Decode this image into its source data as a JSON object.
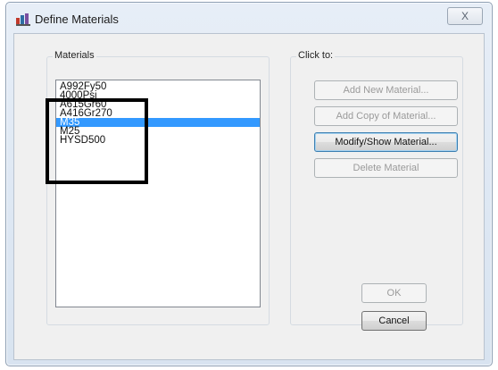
{
  "window": {
    "title": "Define Materials",
    "close_label": "X"
  },
  "materials_group": {
    "label": "Materials",
    "items": [
      {
        "label": "A992Fy50",
        "selected": false
      },
      {
        "label": "4000Psi",
        "selected": false
      },
      {
        "label": "A615Gr60",
        "selected": false
      },
      {
        "label": "A416Gr270",
        "selected": false
      },
      {
        "label": "M35",
        "selected": true
      },
      {
        "label": "M25",
        "selected": false
      },
      {
        "label": "HYSD500",
        "selected": false
      }
    ]
  },
  "click_to_group": {
    "label": "Click to:",
    "add_new_label": "Add New Material...",
    "add_copy_label": "Add Copy of Material...",
    "modify_show_label": "Modify/Show Material...",
    "delete_label": "Delete Material"
  },
  "footer": {
    "ok_label": "OK",
    "cancel_label": "Cancel"
  },
  "colors": {
    "selection": "#3399ff",
    "annotation_box": "#000000"
  }
}
